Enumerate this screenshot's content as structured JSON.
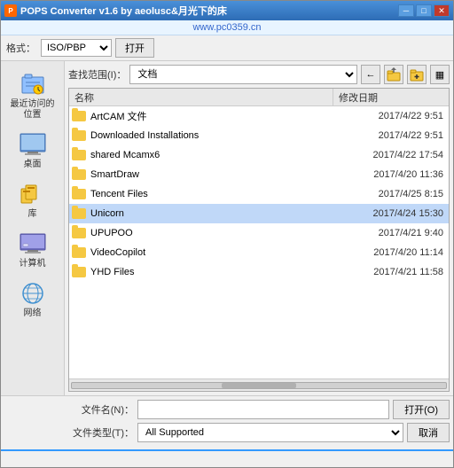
{
  "window": {
    "title": "POPS Converter v1.6 by aeolusc&月光下的床",
    "watermark": "www.pc0359.cn"
  },
  "toolbar": {
    "format_label": "格式：",
    "format_options": [
      "ISO/PBP"
    ],
    "format_value": "ISO/PBP",
    "open_button": "打开"
  },
  "address_bar": {
    "label": "查找范围(I)：",
    "value": "文档",
    "nav_back": "←",
    "nav_folder_up": "📁",
    "nav_new_folder": "📂",
    "nav_view": "▦"
  },
  "columns": {
    "name": "名称",
    "date": "修改日期"
  },
  "files": [
    {
      "name": "ArtCAM 文件",
      "date": "2017/4/22 9:51"
    },
    {
      "name": "Downloaded Installations",
      "date": "2017/4/22 9:51"
    },
    {
      "name": "shared Mcamx6",
      "date": "2017/4/22 17:54"
    },
    {
      "name": "SmartDraw",
      "date": "2017/4/20 11:36"
    },
    {
      "name": "Tencent Files",
      "date": "2017/4/25 8:15"
    },
    {
      "name": "Unicorn",
      "date": "2017/4/24 15:30"
    },
    {
      "name": "UPUPOO",
      "date": "2017/4/21 9:40"
    },
    {
      "name": "VideoCopilot",
      "date": "2017/4/20 11:14"
    },
    {
      "name": "YHD Files",
      "date": "2017/4/21 11:58"
    }
  ],
  "sidebar": {
    "items": [
      {
        "label": "最近访问的位置",
        "icon": "recent"
      },
      {
        "label": "桌面",
        "icon": "desktop"
      },
      {
        "label": "库",
        "icon": "library"
      },
      {
        "label": "计算机",
        "icon": "computer"
      },
      {
        "label": "网络",
        "icon": "network"
      }
    ]
  },
  "bottom": {
    "filename_label": "文件名(N)：",
    "filename_value": "",
    "filetype_label": "文件类型(T)：",
    "filetype_value": "All Supported",
    "filetype_options": [
      "All Supported"
    ],
    "open_btn": "打开(O)",
    "cancel_btn": "取消"
  },
  "status": {
    "text": ""
  },
  "title_buttons": {
    "minimize": "─",
    "maximize": "□",
    "close": "✕"
  }
}
